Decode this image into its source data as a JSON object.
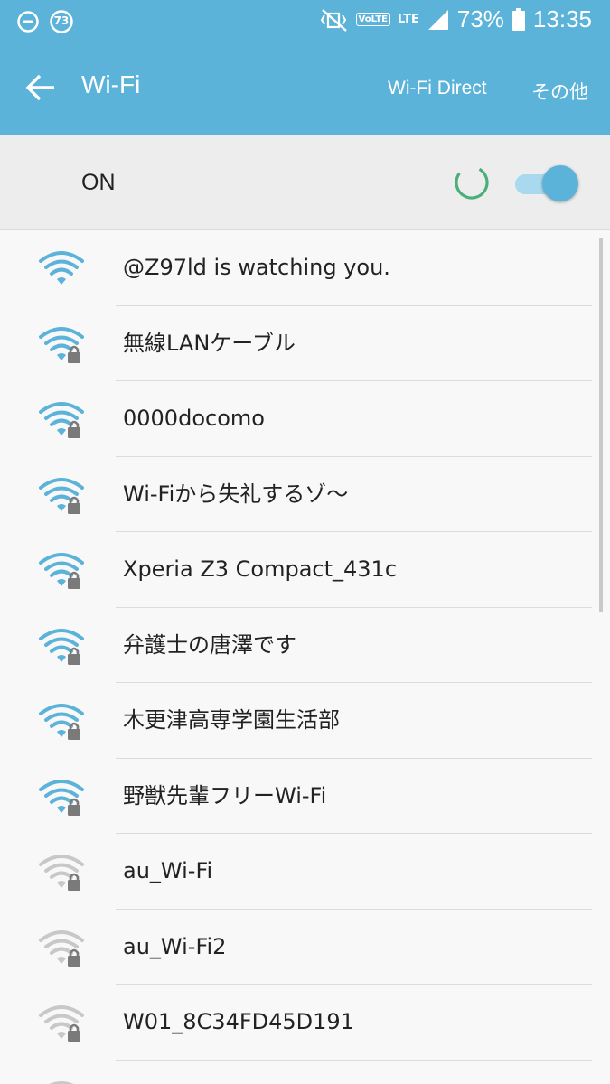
{
  "status_bar": {
    "badge_count": "73",
    "network_volte": "VoLTE",
    "network_lte": "LTE",
    "battery_percent": "73%",
    "time": "13:35"
  },
  "app_bar": {
    "title": "Wi-Fi",
    "wifi_direct_label": "Wi-Fi Direct",
    "more_label": "その他"
  },
  "wifi_toggle": {
    "label": "ON",
    "state": "on"
  },
  "networks": [
    {
      "ssid": "@Z97ld is watching you.",
      "secured": false,
      "strength": "strong"
    },
    {
      "ssid": "無線LANケーブル",
      "secured": true,
      "strength": "strong"
    },
    {
      "ssid": "0000docomo",
      "secured": true,
      "strength": "strong"
    },
    {
      "ssid": "Wi-Fiから失礼するゾ〜",
      "secured": true,
      "strength": "strong"
    },
    {
      "ssid": "Xperia Z3 Compact_431c",
      "secured": true,
      "strength": "strong"
    },
    {
      "ssid": "弁護士の唐澤です",
      "secured": true,
      "strength": "strong"
    },
    {
      "ssid": "木更津高専学園生活部",
      "secured": true,
      "strength": "strong"
    },
    {
      "ssid": "野獣先輩フリーWi-Fi",
      "secured": true,
      "strength": "strong"
    },
    {
      "ssid": "au_Wi-Fi",
      "secured": true,
      "strength": "weak"
    },
    {
      "ssid": "au_Wi-Fi2",
      "secured": true,
      "strength": "weak"
    },
    {
      "ssid": "W01_8C34FD45D191",
      "secured": true,
      "strength": "weak"
    },
    {
      "ssid": "",
      "secured": true,
      "strength": "weak"
    }
  ],
  "colors": {
    "accent": "#5cb3d9",
    "signal_strong": "#5cb3d9",
    "signal_weak": "#c8c8c8",
    "lock": "#7a7a7a",
    "spinner_green": "#4caf7a"
  },
  "icons": {
    "back": "arrow-left-icon",
    "signal": "wifi-signal-icon",
    "lock": "lock-icon"
  }
}
